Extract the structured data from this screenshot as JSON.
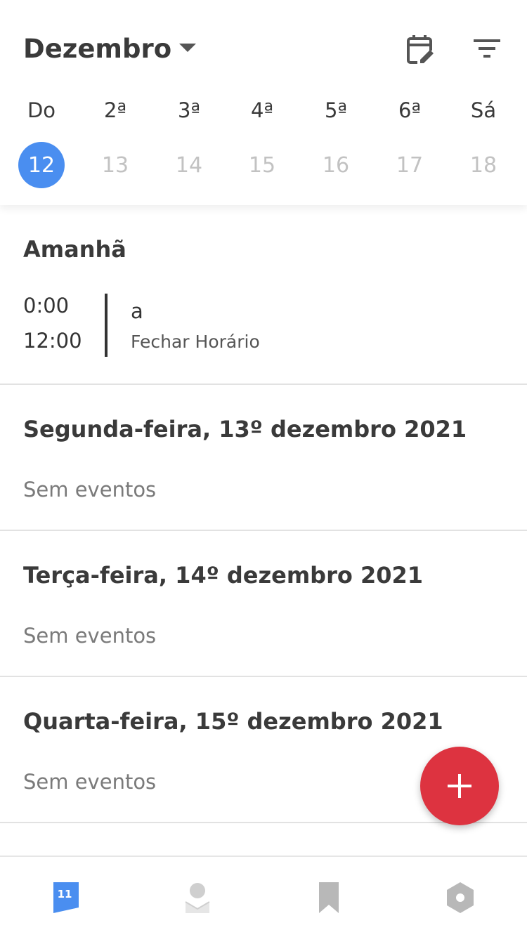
{
  "header": {
    "month": "Dezembro",
    "week_days": [
      "Do",
      "2ª",
      "3ª",
      "4ª",
      "5ª",
      "6ª",
      "Sá"
    ],
    "dates": [
      "12",
      "13",
      "14",
      "15",
      "16",
      "17",
      "18"
    ],
    "selected_date": "12",
    "accent_color": "#4a8ef0"
  },
  "sections": [
    {
      "title": "Amanhã",
      "events": [
        {
          "start": "0:00",
          "end": "12:00",
          "title": "a",
          "subtitle": "Fechar Horário"
        }
      ]
    },
    {
      "title": "Segunda-feira, 13º dezembro 2021",
      "empty_text": "Sem eventos"
    },
    {
      "title": "Terça-feira, 14º dezembro 2021",
      "empty_text": "Sem eventos"
    },
    {
      "title": "Quarta-feira, 15º dezembro 2021",
      "empty_text": "Sem eventos"
    }
  ],
  "fab": {
    "icon": "plus-icon",
    "color": "#dd3340"
  },
  "bottom_nav": {
    "items": [
      {
        "icon": "calendar-flag-icon",
        "badge": "11",
        "active": true
      },
      {
        "icon": "contact-icon",
        "active": false
      },
      {
        "icon": "bookmark-icon",
        "active": false
      },
      {
        "icon": "settings-hexagon-icon",
        "active": false
      }
    ]
  }
}
